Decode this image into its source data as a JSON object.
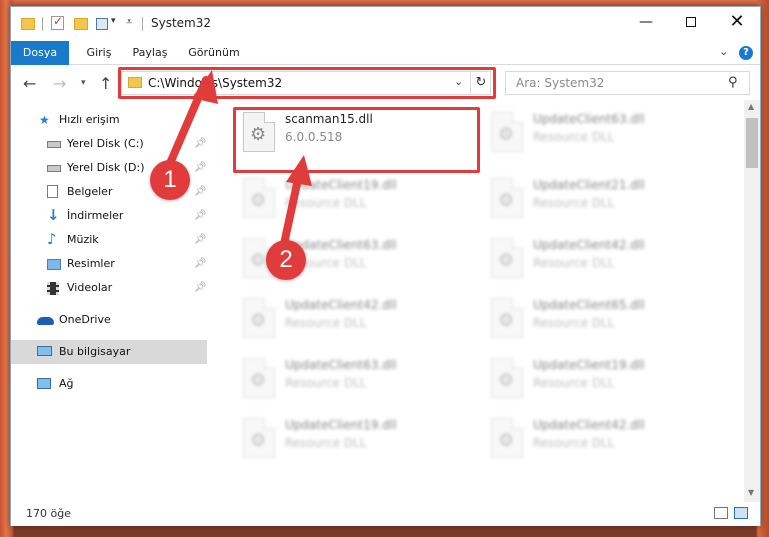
{
  "window": {
    "title": "System32",
    "min_glyph": "—",
    "close_glyph": "✕"
  },
  "ribbon": {
    "tabs": [
      "Dosya",
      "Giriş",
      "Paylaş",
      "Görünüm"
    ],
    "help": "?"
  },
  "nav": {
    "address": "C:\\Windows\\System32",
    "search_placeholder": "Ara: System32"
  },
  "sidebar": {
    "items": [
      {
        "label": "Hızlı erişim",
        "icon": "star-icon",
        "pinned": false
      },
      {
        "label": "Yerel Disk (C:)",
        "icon": "drive-icon",
        "pinned": true
      },
      {
        "label": "Yerel Disk (D:)",
        "icon": "drive-icon",
        "pinned": true
      },
      {
        "label": "Belgeler",
        "icon": "documents-icon",
        "pinned": true
      },
      {
        "label": "İndirmeler",
        "icon": "download-icon",
        "pinned": true
      },
      {
        "label": "Müzik",
        "icon": "music-icon",
        "pinned": true
      },
      {
        "label": "Resimler",
        "icon": "pictures-icon",
        "pinned": true
      },
      {
        "label": "Videolar",
        "icon": "video-icon",
        "pinned": true
      },
      {
        "label": "OneDrive",
        "icon": "cloud-icon",
        "pinned": false
      },
      {
        "label": "Bu bilgisayar",
        "icon": "computer-icon",
        "pinned": false,
        "selected": true
      },
      {
        "label": "Ağ",
        "icon": "network-icon",
        "pinned": false
      }
    ]
  },
  "files": [
    {
      "name": "scanman15.dll",
      "sub": "6.0.0.518",
      "highlighted": true
    },
    {
      "name": "UpdateClient63.dll",
      "sub": "Resource DLL"
    },
    {
      "name": "UpdateClient19.dll",
      "sub": "Resource DLL"
    },
    {
      "name": "UpdateClient21.dll",
      "sub": "Resource DLL"
    },
    {
      "name": "UpdateClient63.dll",
      "sub": "Resource DLL"
    },
    {
      "name": "UpdateClient42.dll",
      "sub": "Resource DLL"
    },
    {
      "name": "UpdateClient42.dll",
      "sub": "Resource DLL"
    },
    {
      "name": "UpdateClient65.dll",
      "sub": "Resource DLL"
    },
    {
      "name": "UpdateClient63.dll",
      "sub": "Resource DLL"
    },
    {
      "name": "UpdateClient19.dll",
      "sub": "Resource DLL"
    },
    {
      "name": "UpdateClient19.dll",
      "sub": "Resource DLL"
    },
    {
      "name": "UpdateClient42.dll",
      "sub": "Resource DLL"
    }
  ],
  "status": {
    "item_count": "170 öğe"
  },
  "annotations": {
    "step1": "1",
    "step2": "2",
    "color": "#e03c3c"
  }
}
